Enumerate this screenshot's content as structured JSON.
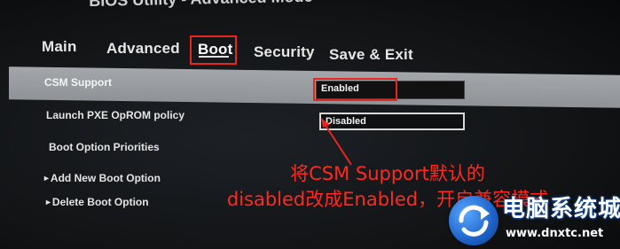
{
  "window_title": "BIOS Utility - Advanced Mode",
  "tabs": [
    {
      "label": "Main"
    },
    {
      "label": "Advanced"
    },
    {
      "label": "Boot",
      "active": true
    },
    {
      "label": "Security"
    },
    {
      "label": "Save & Exit"
    }
  ],
  "settings": {
    "csm_support": {
      "label": "CSM Support",
      "value": "Enabled"
    },
    "launch_pxe": {
      "label": "Launch PXE OpROM policy",
      "value": "Disabled"
    },
    "boot_option_priorities": {
      "label": "Boot Option Priorities"
    },
    "add_new_boot_option": {
      "label": "Add New Boot Option"
    },
    "delete_boot_option": {
      "label": "Delete Boot Option"
    }
  },
  "annotation": {
    "line1": "将CSM Support默认的",
    "line2": "disabled改成Enabled，开启兼容模式"
  },
  "watermark": {
    "title": "电脑系统城",
    "url": "www.dnxtc.net",
    "logo_icon": "refresh-arrow-icon"
  },
  "colors": {
    "highlight_row": "#9a9ea2",
    "annotation_red": "#ff2a1f",
    "box_red": "#e8261e",
    "watermark_blue": "#1d62c9"
  }
}
